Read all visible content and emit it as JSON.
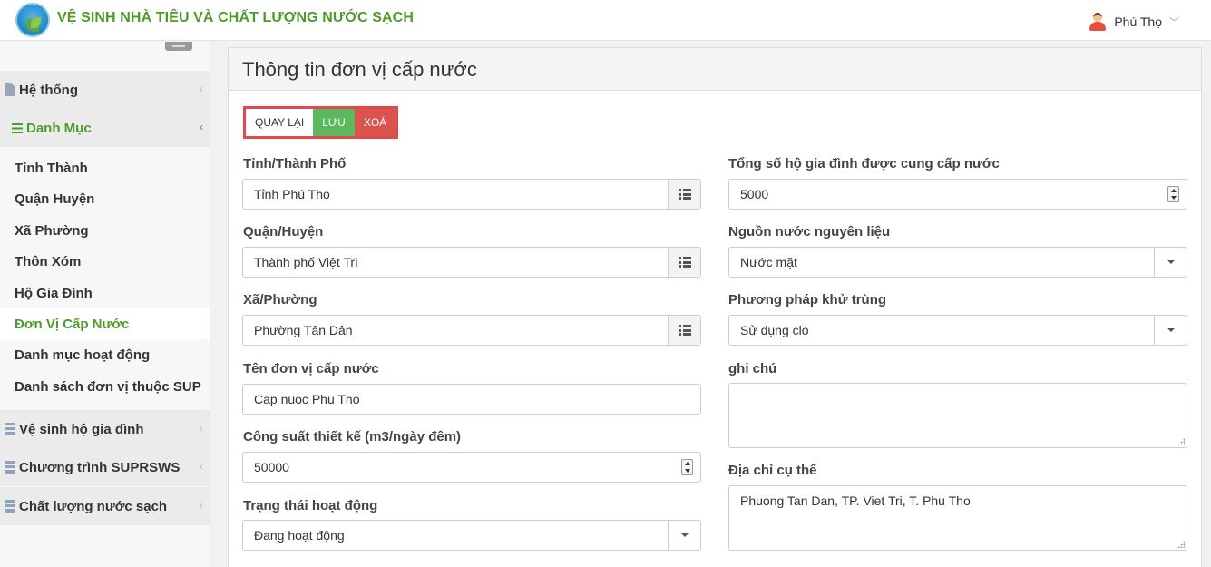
{
  "header": {
    "app_title": "VỆ SINH NHÀ TIÊU VÀ CHẤT LƯỢNG NƯỚC SẠCH",
    "user_name": "Phú Thọ",
    "user_chevron": "﹀"
  },
  "sidebar": {
    "groups": [
      {
        "label": "Hệ thống",
        "icon": "file-icon"
      },
      {
        "label": "Danh Mục",
        "icon": "bars-icon"
      },
      {
        "label": "Vệ sinh hộ gia đình",
        "icon": "database-icon"
      },
      {
        "label": "Chương trình SUPRSWS",
        "icon": "database-icon"
      },
      {
        "label": "Chất lượng nước sạch",
        "icon": "database-icon"
      }
    ],
    "items": [
      {
        "label": "Tỉnh Thành"
      },
      {
        "label": "Quận Huyện"
      },
      {
        "label": "Xã Phường"
      },
      {
        "label": "Thôn Xóm"
      },
      {
        "label": "Hộ Gia Đình"
      },
      {
        "label": "Đơn Vị Cấp Nước"
      },
      {
        "label": "Danh mục hoạt động"
      },
      {
        "label": "Danh sách đơn vị thuộc SUP"
      }
    ],
    "caret": "‹"
  },
  "panel": {
    "title": "Thông tin đơn vị cấp nước",
    "buttons": {
      "back": "QUAY LẠI",
      "save": "LƯU",
      "delete": "XOÁ"
    }
  },
  "form": {
    "province": {
      "label": "Tỉnh/Thành Phố",
      "value": "Tỉnh Phú Thọ"
    },
    "district": {
      "label": "Quận/Huyện",
      "value": "Thành phố Việt Trì"
    },
    "ward": {
      "label": "Xã/Phường",
      "value": "Phường Tân Dân"
    },
    "unit_name": {
      "label": "Tên đơn vị cấp nước",
      "value": "Cap nuoc Phu Tho"
    },
    "capacity": {
      "label": "Công suất thiết kế (m3/ngày đêm)",
      "value": "50000"
    },
    "status": {
      "label": "Trạng thái hoạt động",
      "value": "Đang hoạt động"
    },
    "households": {
      "label": "Tổng số hộ gia đình được cung cấp nước",
      "value": "5000"
    },
    "source": {
      "label": "Nguồn nước nguyên liệu",
      "value": "Nước mặt"
    },
    "disinfection": {
      "label": "Phương pháp khử trùng",
      "value": "Sử dụng clo"
    },
    "note": {
      "label": "ghi chú",
      "value": ""
    },
    "address": {
      "label": "Địa chỉ cụ thể",
      "value": "Phuong Tan Dan, TP. Viet Tri, T. Phu Tho"
    }
  }
}
